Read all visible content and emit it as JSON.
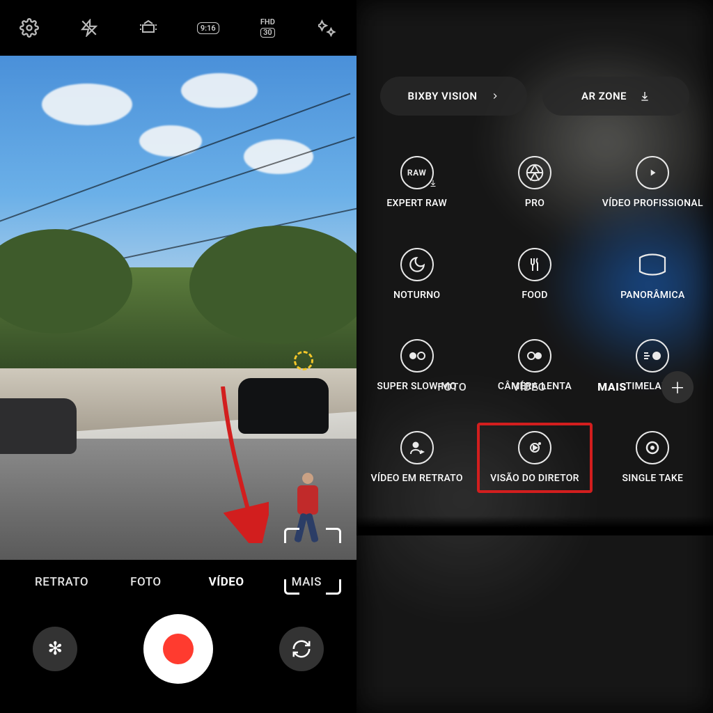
{
  "left": {
    "top_icons": {
      "settings": "settings-icon",
      "flash": "flash-off-icon",
      "motion": "motion-photo-icon",
      "aspect_ratio": "9:16",
      "resolution_label": "FHD",
      "resolution_fps": "30",
      "effects": "effects-icon"
    },
    "modes": {
      "retrato": "RETRATO",
      "foto": "FOTO",
      "video": "VÍDEO",
      "mais": "MAIS",
      "selected": "video"
    },
    "arrow_target": "mais"
  },
  "right": {
    "chips": {
      "bixby": "BIXBY VISION",
      "arzone": "AR ZONE"
    },
    "grid": [
      {
        "id": "expert_raw",
        "label": "EXPERT RAW",
        "icon": "raw-icon"
      },
      {
        "id": "pro",
        "label": "PRO",
        "icon": "aperture-icon"
      },
      {
        "id": "pro_video",
        "label": "VÍDEO PROFISSIONAL",
        "icon": "pro-video-icon"
      },
      {
        "id": "noturno",
        "label": "NOTURNO",
        "icon": "moon-icon"
      },
      {
        "id": "food",
        "label": "FOOD",
        "icon": "food-icon"
      },
      {
        "id": "panorama",
        "label": "PANORÂMICA",
        "icon": "panorama-icon"
      },
      {
        "id": "super_slow",
        "label": "SUPER SLOW-MO",
        "icon": "super-slowmo-icon"
      },
      {
        "id": "slow",
        "label": "CÂMERA LENTA",
        "icon": "slowmo-icon"
      },
      {
        "id": "timelapse",
        "label": "TIMELAPSE",
        "icon": "timelapse-icon"
      },
      {
        "id": "portrait_vid",
        "label": "VÍDEO EM RETRATO",
        "icon": "portrait-video-icon"
      },
      {
        "id": "director",
        "label": "VISÃO DO DIRETOR",
        "icon": "director-icon"
      },
      {
        "id": "single_take",
        "label": "SINGLE TAKE",
        "icon": "single-take-icon"
      }
    ],
    "highlight": "director",
    "modes": {
      "foto": "FOTO",
      "video": "VÍDEO",
      "mais": "MAIS",
      "selected": "mais"
    }
  }
}
